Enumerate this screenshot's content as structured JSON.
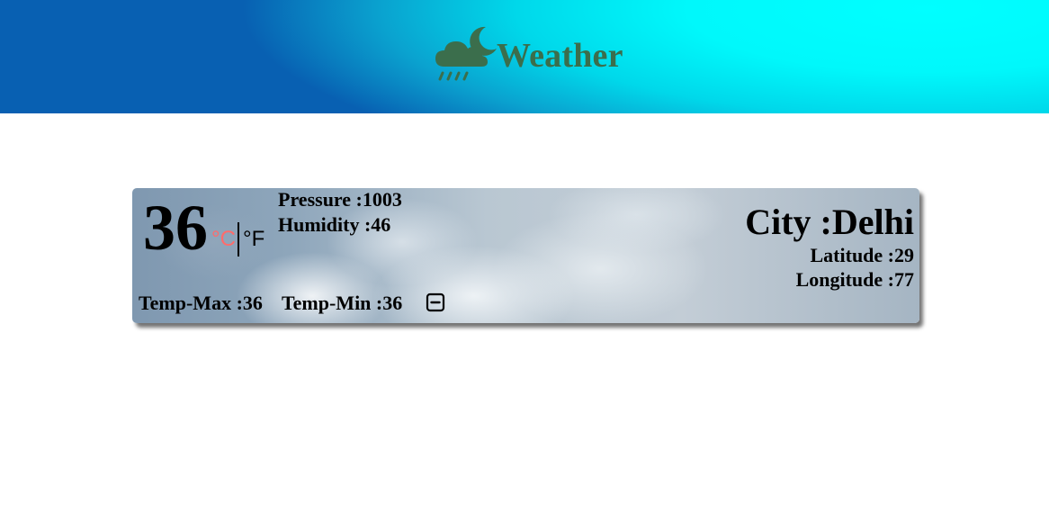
{
  "header": {
    "title": "Weather",
    "icon": "cloud-moon-rain-icon",
    "title_color": "#3b6e4c"
  },
  "weather": {
    "temperature": "36",
    "unit_celsius": "°C",
    "unit_fahrenheit": "°F",
    "active_unit_color": "#ff6b6b",
    "pressure": "Pressure :1003",
    "humidity": "Humidity :46",
    "temp_max": "Temp-Max :36",
    "temp_min": "Temp-Min :36",
    "toggle_icon": "minus-square-icon"
  },
  "location": {
    "city": "City :Delhi",
    "latitude": "Latitude :29",
    "longitude": "Longitude :77"
  }
}
